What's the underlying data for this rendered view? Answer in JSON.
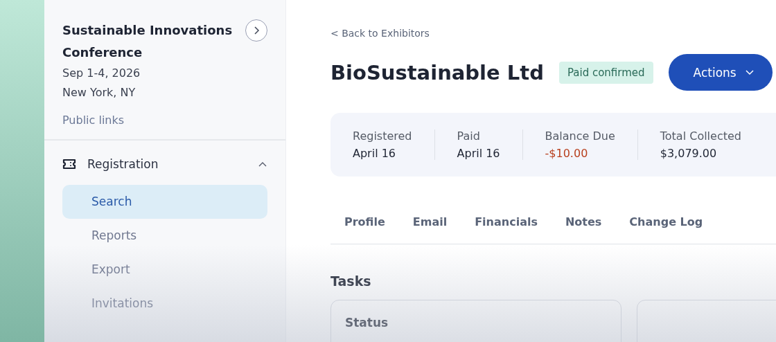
{
  "event": {
    "name": "Sustainable Innovations Conference",
    "dates": "Sep 1-4, 2026",
    "location": "New York, NY",
    "link": "Public links"
  },
  "nav": {
    "section": "Registration",
    "expanded": true,
    "items": [
      {
        "label": "Search",
        "selected": true
      },
      {
        "label": "Reports",
        "selected": false
      },
      {
        "label": "Export",
        "selected": false
      },
      {
        "label": "Invitations",
        "selected": false
      }
    ]
  },
  "back_link": "< Back to Exhibitors",
  "title": "BioSustainable Ltd",
  "badge": "Paid confirmed",
  "actions_button": "Actions",
  "stats": [
    {
      "label": "Registered",
      "value": "April 16",
      "negative": false
    },
    {
      "label": "Paid",
      "value": "April 16",
      "negative": false
    },
    {
      "label": "Balance Due",
      "value": "-$10.00",
      "negative": true
    },
    {
      "label": "Total Collected",
      "value": "$3,079.00",
      "negative": false
    }
  ],
  "tabs": [
    "Profile",
    "Email",
    "Financials",
    "Notes",
    "Change Log"
  ],
  "tasks": {
    "heading": "Tasks",
    "card_heading": "Status"
  }
}
